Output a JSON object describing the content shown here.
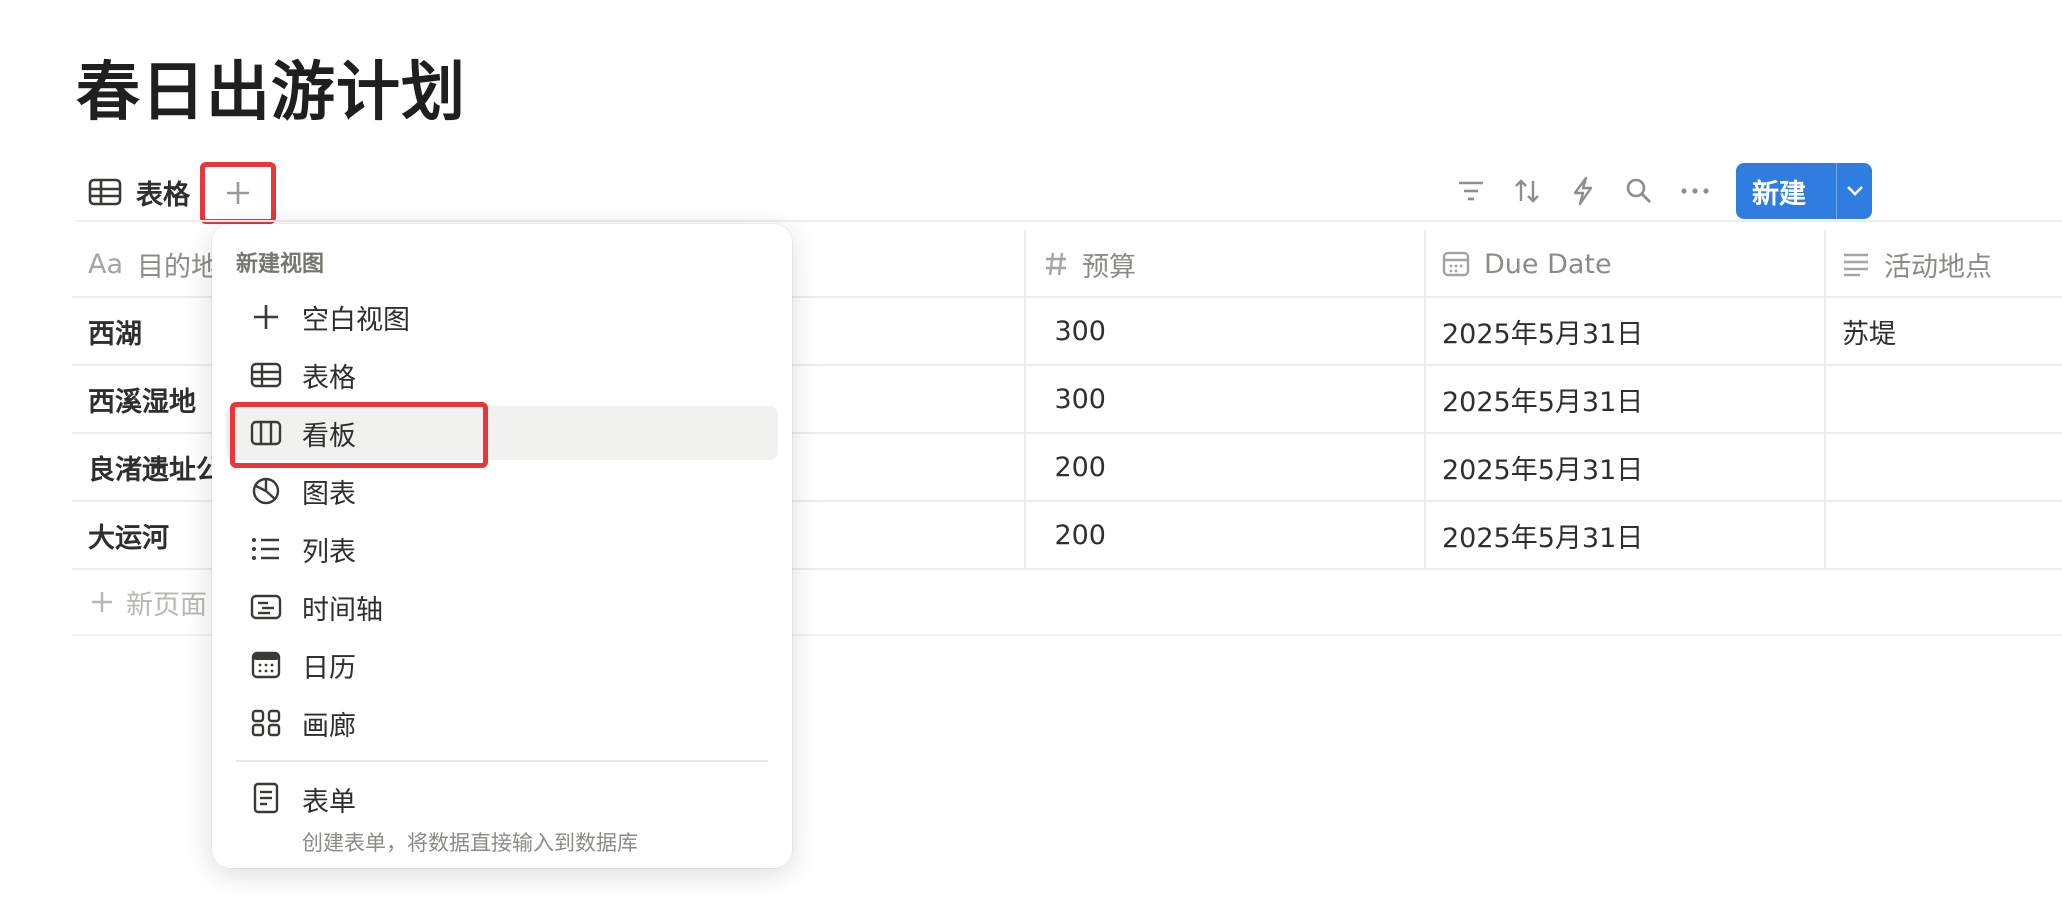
{
  "page": {
    "title": "春日出游计划"
  },
  "toolbar": {
    "view_label": "表格",
    "new_button_label": "新建",
    "tools": [
      "filter-icon",
      "sort-icon",
      "automation-icon",
      "search-icon",
      "more-icon"
    ]
  },
  "table": {
    "columns": [
      {
        "prefix": "Aa",
        "label": "目的地"
      },
      {
        "label": "预算"
      },
      {
        "label": "Due Date"
      },
      {
        "label": "活动地点"
      }
    ],
    "rows": [
      {
        "name": "西湖",
        "budget": "300",
        "due": "2025年5月31日",
        "place": "苏堤"
      },
      {
        "name": "西溪湿地",
        "budget": "300",
        "due": "2025年5月31日",
        "place": ""
      },
      {
        "name": "良渚遗址公",
        "budget": "200",
        "due": "2025年5月31日",
        "place": ""
      },
      {
        "name": "大运河",
        "budget": "200",
        "due": "2025年5月31日",
        "place": ""
      }
    ],
    "new_page_label": "新页面"
  },
  "menu": {
    "header": "新建视图",
    "items": [
      {
        "icon": "plus-icon",
        "label": "空白视图"
      },
      {
        "icon": "table-icon",
        "label": "表格"
      },
      {
        "icon": "board-icon",
        "label": "看板"
      },
      {
        "icon": "chart-icon",
        "label": "图表"
      },
      {
        "icon": "list-icon",
        "label": "列表"
      },
      {
        "icon": "timeline-icon",
        "label": "时间轴"
      },
      {
        "icon": "calendar-icon",
        "label": "日历"
      },
      {
        "icon": "gallery-icon",
        "label": "画廊"
      }
    ],
    "form": {
      "icon": "form-icon",
      "label": "表单",
      "description": "创建表单，将数据直接输入到数据库"
    }
  },
  "colors": {
    "accent": "#2f7de1",
    "annotation": "#e8363b"
  }
}
